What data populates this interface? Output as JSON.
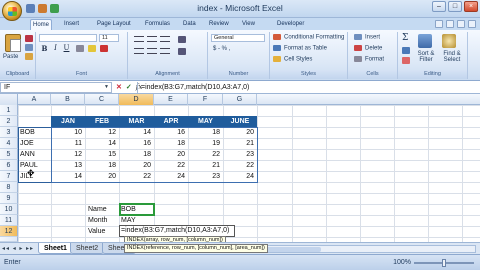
{
  "window": {
    "title": "index - Microsoft Excel",
    "controls": [
      "–",
      "□",
      "×"
    ]
  },
  "ribbon_tabs": [
    "Home",
    "Insert",
    "Page Layout",
    "Formulas",
    "Data",
    "Review",
    "View",
    "Developer"
  ],
  "ribbon": {
    "clipboard": {
      "paste": "Paste",
      "label": "Clipboard"
    },
    "font": {
      "font_name": "",
      "font_size": "11",
      "label": "Font",
      "bold": "B",
      "italic": "I",
      "underline": "U"
    },
    "alignment": {
      "label": "Alignment"
    },
    "number": {
      "format": "General",
      "currency": "$ - % ,",
      "label": "Number"
    },
    "styles": {
      "conditional": "Conditional Formatting",
      "format_table": "Format as Table",
      "cell_styles": "Cell Styles",
      "label": "Styles"
    },
    "cells": {
      "insert": "Insert",
      "delete": "Delete",
      "format": "Format",
      "label": "Cells"
    },
    "editing": {
      "sigma": "Σ",
      "sort": "Sort & Filter",
      "find": "Find & Select",
      "label": "Editing"
    }
  },
  "formula_bar": {
    "name_box": "IF",
    "cancel": "✕",
    "enter": "✓",
    "fx": "fx",
    "formula": "=index(B3:G7,match(D10,A3:A7,0)"
  },
  "columns": [
    "A",
    "B",
    "C",
    "D",
    "E",
    "F",
    "G"
  ],
  "rows": [
    "1",
    "2",
    "3",
    "4",
    "5",
    "6",
    "7",
    "8",
    "9",
    "10",
    "11",
    "12",
    "13"
  ],
  "table": {
    "headers": [
      "JAN",
      "FEB",
      "MAR",
      "APR",
      "MAY",
      "JUNE"
    ],
    "rows": [
      {
        "name": "BOB",
        "values": [
          "10",
          "12",
          "14",
          "16",
          "18",
          "20"
        ]
      },
      {
        "name": "JOE",
        "values": [
          "11",
          "14",
          "16",
          "18",
          "19",
          "21"
        ]
      },
      {
        "name": "ANN",
        "values": [
          "12",
          "15",
          "18",
          "20",
          "22",
          "23"
        ]
      },
      {
        "name": "PAUL",
        "values": [
          "13",
          "18",
          "20",
          "22",
          "21",
          "22"
        ]
      },
      {
        "name": "JILL",
        "values": [
          "14",
          "20",
          "22",
          "24",
          "23",
          "24"
        ]
      }
    ]
  },
  "lookup": {
    "name_label": "Name",
    "name_value": "BOB",
    "month_label": "Month",
    "month_value": "MAY",
    "value_label": "Value",
    "value_formula": "=index(B3:G7,match(D10,A3:A7,0)"
  },
  "tooltip": {
    "line1": "INDEX(array, row_num, [column_num])",
    "line2": "INDEX(reference, row_num, [column_num], [area_num])"
  },
  "sheets": [
    "Sheet1",
    "Sheet2",
    "Sheet3"
  ],
  "status": {
    "mode": "Enter",
    "zoom": "100%"
  }
}
